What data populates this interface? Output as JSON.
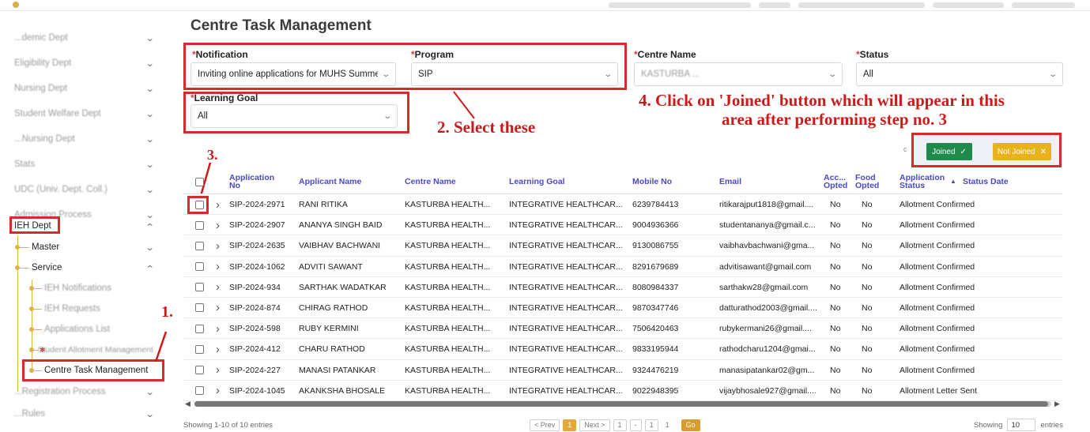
{
  "colors": {
    "accent": "#e2a93a",
    "annotation": "#cc1a1a",
    "joined": "#1f8a4c",
    "not_joined": "#e8b21d",
    "header_text": "#4a4ac2"
  },
  "sidebar": {
    "items": [
      {
        "label": "...demic Dept",
        "blurred": true
      },
      {
        "label": "Eligibility Dept",
        "blurred": true
      },
      {
        "label": "Nursing Dept",
        "blurred": true
      },
      {
        "label": "Student Welfare Dept",
        "blurred": true
      },
      {
        "label": "...Nursing Dept",
        "blurred": true
      },
      {
        "label": "Stats",
        "blurred": true
      },
      {
        "label": "UDC (Univ. Dept. Coll.)",
        "blurred": true
      },
      {
        "label": "Admission Process",
        "blurred": true
      },
      {
        "label": "IEH Dept",
        "blurred": false
      }
    ],
    "ieh_children": {
      "master": "Master",
      "service": "Service",
      "service_children": [
        "IEH Notifications",
        "IEH Requests",
        "Applications List",
        "Student Allotment Management",
        "Centre Task Management"
      ]
    },
    "after_items": [
      {
        "label": "...Registration Process",
        "blurred": true
      },
      {
        "label": "...Rules",
        "blurred": true
      }
    ]
  },
  "page": {
    "title": "Centre Task Management",
    "filters": {
      "notification": {
        "label": "Notification",
        "value": "Inviting online applications for MUHS Summer"
      },
      "program": {
        "label": "Program",
        "value": "SIP"
      },
      "centre_name": {
        "label": "Centre Name",
        "value": "KASTURBA ..."
      },
      "status": {
        "label": "Status",
        "value": "All"
      },
      "learning_goal": {
        "label": "Learning Goal",
        "value": "All"
      }
    },
    "actions": {
      "joined": "Joined",
      "not_joined": "Not Joined"
    }
  },
  "annotations": {
    "step1": "1.",
    "step2": "2. Select these",
    "step3": "3.",
    "step4_line1": "4. Click on 'Joined' button which will appear in this",
    "step4_line2": "area after performing step no. 3"
  },
  "table": {
    "headers": {
      "app_no": "Application No",
      "name": "Applicant Name",
      "centre": "Centre Name",
      "goal": "Learning Goal",
      "mobile": "Mobile No",
      "email": "Email",
      "acc": "Acc... Opted",
      "food": "Food Opted",
      "app_status": "Application Status",
      "status_date": "Status Date"
    },
    "rows": [
      [
        "SIP-2024-2971",
        "RANI RITIKA",
        "KASTURBA HEALTH...",
        "INTEGRATIVE HEALTHCAR...",
        "6239784413",
        "ritikarajput1818@gmail....",
        "No",
        "No",
        "Allotment Confirmed"
      ],
      [
        "SIP-2024-2907",
        "ANANYA SINGH BAID",
        "KASTURBA HEALTH...",
        "INTEGRATIVE HEALTHCAR...",
        "9004936366",
        "studentananya@gmail.c...",
        "No",
        "No",
        "Allotment Confirmed"
      ],
      [
        "SIP-2024-2635",
        "VAIBHAV BACHWANI",
        "KASTURBA HEALTH...",
        "INTEGRATIVE HEALTHCAR...",
        "9130086755",
        "vaibhavbachwani@gma...",
        "No",
        "No",
        "Allotment Confirmed"
      ],
      [
        "SIP-2024-1062",
        "ADVITI SAWANT",
        "KASTURBA HEALTH...",
        "INTEGRATIVE HEALTHCAR...",
        "8291679689",
        "advitisawant@gmail.com",
        "No",
        "No",
        "Allotment Confirmed"
      ],
      [
        "SIP-2024-934",
        "SARTHAK WADATKAR",
        "KASTURBA HEALTH...",
        "INTEGRATIVE HEALTHCAR...",
        "8080984337",
        "sarthakw28@gmail.com",
        "No",
        "No",
        "Allotment Confirmed"
      ],
      [
        "SIP-2024-874",
        "CHIRAG RATHOD",
        "KASTURBA HEALTH...",
        "INTEGRATIVE HEALTHCAR...",
        "9870347746",
        "datturathod2003@gmail....",
        "No",
        "No",
        "Allotment Confirmed"
      ],
      [
        "SIP-2024-598",
        "RUBY KERMINI",
        "KASTURBA HEALTH...",
        "INTEGRATIVE HEALTHCAR...",
        "7506420463",
        "rubykermani26@gmail....",
        "No",
        "No",
        "Allotment Confirmed"
      ],
      [
        "SIP-2024-412",
        "CHARU RATHOD",
        "KASTURBA HEALTH...",
        "INTEGRATIVE HEALTHCAR...",
        "9833195944",
        "rathodcharu1204@gmai...",
        "No",
        "No",
        "Allotment Confirmed"
      ],
      [
        "SIP-2024-227",
        "MANASI PATANKAR",
        "KASTURBA HEALTH...",
        "INTEGRATIVE HEALTHCAR...",
        "9324476219",
        "manasipatankar02@gm...",
        "No",
        "No",
        "Allotment Confirmed"
      ],
      [
        "SIP-2024-1045",
        "AKANKSHA BHOSALE",
        "KASTURBA HEALTH...",
        "INTEGRATIVE HEALTHCAR...",
        "9022948395",
        "vijaybhosale927@gmail....",
        "No",
        "No",
        "Allotment Letter Sent"
      ]
    ]
  },
  "footer": {
    "showing_text": "Showing 1-10 of 10 entries",
    "prev": "< Prev",
    "current_page": "1",
    "next": "Next >",
    "page_input_1": "1",
    "dash": "-",
    "page_input_2": "1",
    "page_input_3": "1",
    "go": "Go",
    "showing_label": "Showing",
    "entries_value": "10",
    "entries_label": "entries"
  }
}
